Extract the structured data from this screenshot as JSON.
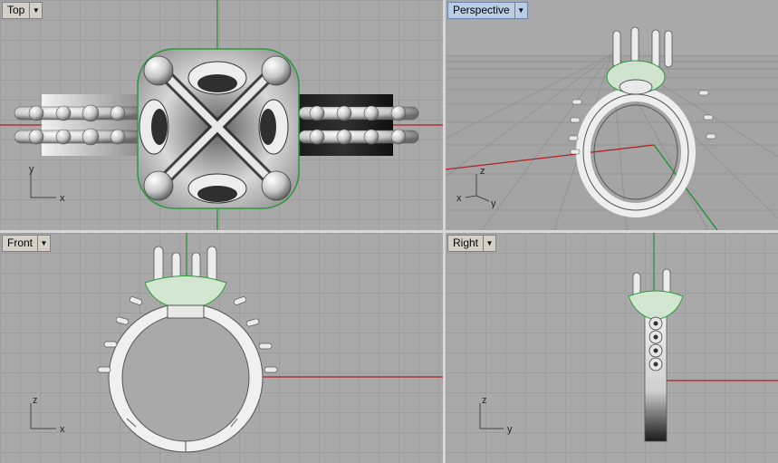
{
  "viewports": {
    "top": {
      "label": "Top",
      "axis_h": "x",
      "axis_v": "y"
    },
    "perspective": {
      "label": "Perspective",
      "axis_h": "y",
      "axis_v": "z",
      "axis_x": "x"
    },
    "front": {
      "label": "Front",
      "axis_h": "x",
      "axis_v": "z"
    },
    "right": {
      "label": "Right",
      "axis_h": "y",
      "axis_v": "z"
    }
  },
  "icons": {
    "dropdown": "chevron-down-icon"
  },
  "colors": {
    "grid_bg": "#a9a9a9",
    "x_axis": "#b02020",
    "y_axis": "#1e8f2a",
    "active_label": "#b9cde6",
    "selection": "#2a9a3a"
  }
}
